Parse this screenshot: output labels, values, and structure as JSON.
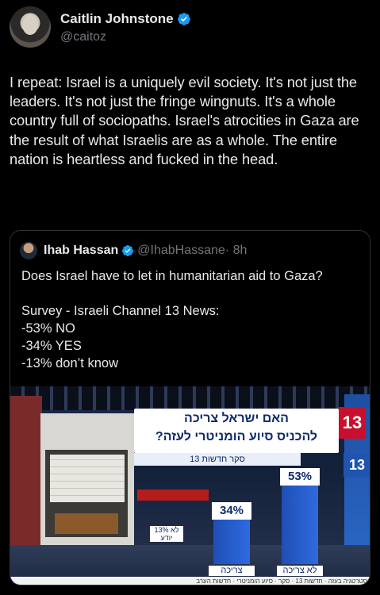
{
  "tweet": {
    "author": {
      "name": "Caitlin Johnstone",
      "handle": "@caitoz"
    },
    "text": "I repeat: Israel is a uniquely evil society. It's not just the leaders. It's not just the fringe wingnuts. It's a whole country full of sociopaths. Israel's atrocities in Gaza are the result of what Israelis are as a whole. The entire nation is heartless and fucked in the head."
  },
  "quote": {
    "author": {
      "name": "Ihab Hassan",
      "handle": "@IhabHassane",
      "time": "· 8h"
    },
    "text": "Does Israel have to let in humanitarian aid to Gaza?\n\nSurvey - Israeli Channel 13 News:\n-53% NO\n-34% YES\n-13% don’t know",
    "media": {
      "headline_line1": "האם ישראל צריכה",
      "headline_line2": "להכניס סיוע הומניטרי לעזה?",
      "subhead": "סקר חדשות 13",
      "logo": "13",
      "logo_side": "13",
      "chart_data": {
        "type": "bar",
        "categories": [
          "לא צריכה",
          "צריכה",
          "לא יודע"
        ],
        "values": [
          53,
          34,
          13
        ],
        "value_labels": [
          "53%",
          "34%",
          "13%"
        ]
      }
    }
  },
  "colors": {
    "background": "#000000",
    "verified": "#1d9bf0",
    "text": "#e7e9ea",
    "muted": "#71767b"
  }
}
